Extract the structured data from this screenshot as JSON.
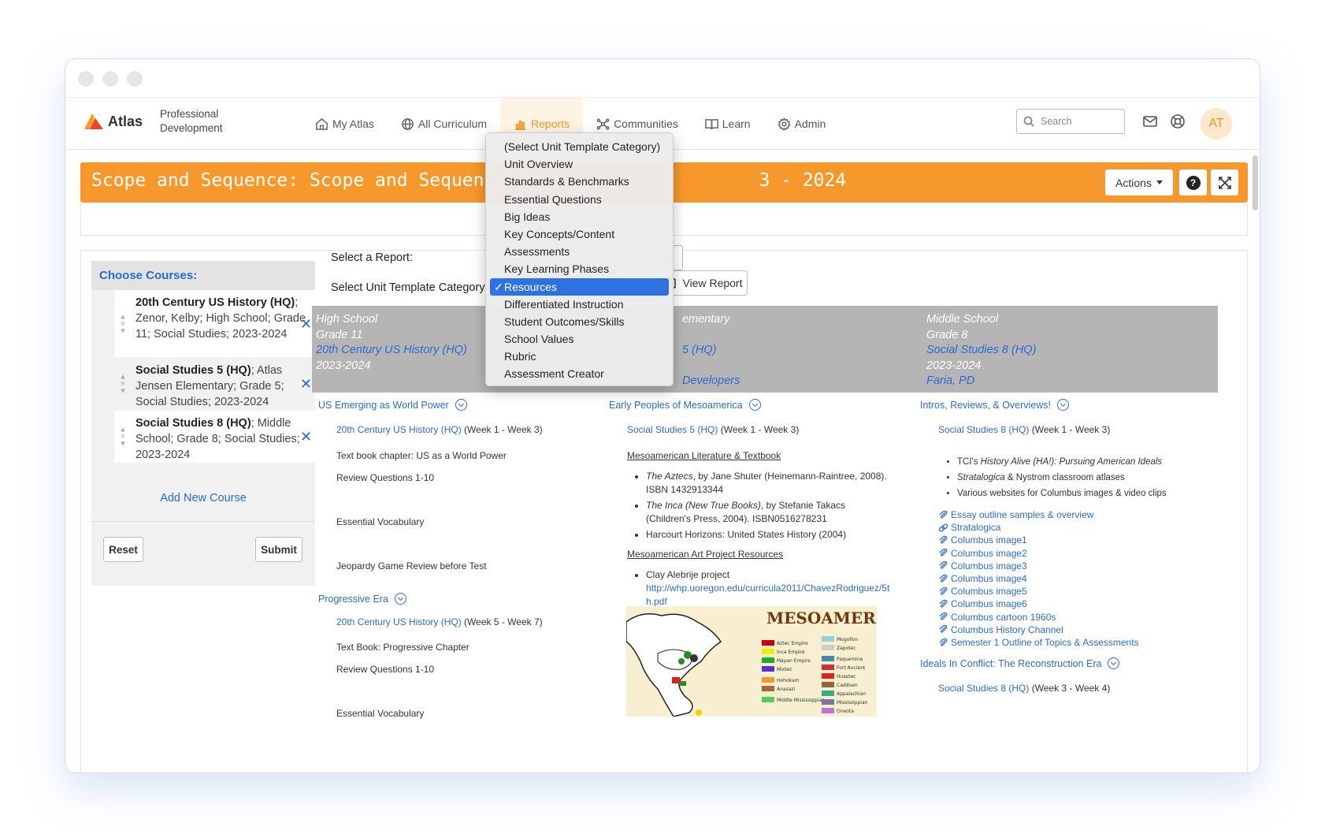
{
  "app": {
    "brand_name": "Atlas",
    "brand_sub": [
      "Professional",
      "Development"
    ],
    "accent_color": "#f7982c",
    "link_color": "#2a6bd1"
  },
  "nav": {
    "items": [
      {
        "label": "My Atlas",
        "icon": "home-icon"
      },
      {
        "label": "All Curriculum",
        "icon": "globe-icon"
      },
      {
        "label": "Reports",
        "icon": "bar-chart-icon",
        "active": true
      },
      {
        "label": "Communities",
        "icon": "network-icon"
      },
      {
        "label": "Learn",
        "icon": "book-icon"
      },
      {
        "label": "Admin",
        "icon": "gear-icon"
      }
    ],
    "search_placeholder": "Search",
    "avatar_initials": "AT"
  },
  "banner": {
    "title_left": "Scope and Sequence: Scope and Sequence Repo",
    "title_right": "3 - 2024",
    "actions_label": "Actions",
    "help_label": "?"
  },
  "left_panel": {
    "header": "Choose Courses:",
    "courses": [
      {
        "name": "20th Century US History (HQ)",
        "detail": "; Zenor, Kelby; High School; Grade 11; Social Studies; 2023-2024"
      },
      {
        "name": "Social Studies 5 (HQ)",
        "detail": "; Atlas Jensen Elementary; Grade 5; Social Studies; 2023-2024"
      },
      {
        "name": "Social Studies 8 (HQ)",
        "detail": "; Middle School; Grade 8; Social Studies; 2023-2024"
      }
    ],
    "add_course": "Add New Course",
    "reset": "Reset",
    "submit": "Submit"
  },
  "form": {
    "select_report_label": "Select a Report:",
    "select_category_label": "Select Unit Template Category:",
    "view_report": "View Report"
  },
  "dropdown": {
    "options": [
      "(Select Unit Template Category)",
      "Unit Overview",
      "Standards & Benchmarks",
      "Essential Questions",
      "Big Ideas",
      "Key Concepts/Content",
      "Assessments",
      "Key Learning Phases",
      "Resources",
      "Differentiated Instruction",
      "Student Outcomes/Skills",
      "School Values",
      "Rubric",
      "Assessment Creator"
    ],
    "selected": "Resources"
  },
  "course_columns": [
    {
      "school": "High School",
      "grade": "Grade 11",
      "course": "20th Century US History (HQ)",
      "year": "2023-2024",
      "teacher": ""
    },
    {
      "school": "ementary",
      "grade": "",
      "course": "5 (HQ)",
      "year": "",
      "teacher": "Developers"
    },
    {
      "school": "Middle School",
      "grade": "Grade 8",
      "course": "Social Studies 8 (HQ)",
      "year": "2023-2024",
      "teacher": "Faria, PD"
    }
  ],
  "col1": {
    "unit1": "US Emerging as World Power",
    "unit1_link": "20th Century US History (HQ)",
    "unit1_weeks": " (Week 1 - Week 3)",
    "unit1_items": [
      "Text book chapter: US as a World Power",
      "Review Questions 1-10",
      "Essential Vocabulary",
      "Jeopardy Game Review before Test"
    ],
    "unit2": "Progressive Era",
    "unit2_link": "20th Century US History (HQ)",
    "unit2_weeks": " (Week 5 - Week 7)",
    "unit2_items": [
      "Text Book: Progressive Chapter",
      "Review Questions 1-10",
      "Essential Vocabulary"
    ]
  },
  "col2": {
    "unit1": "Early Peoples of Mesoamerica",
    "unit1_link": "Social Studies 5 (HQ)",
    "unit1_weeks": " (Week 1 - Week 3)",
    "heading1": "Mesoamerican Literature & Textbook",
    "lit": [
      {
        "title": "The Aztecs",
        "rest": ", by Jane Shuter (Heinemann-Raintree, 2008). ISBN 1432913344"
      },
      {
        "title": "The Inca (New True Books)",
        "rest": ", by Stefanie Takacs (Children's Press, 2004). ISBN0516278231"
      },
      {
        "title": "",
        "rest": "Harcourt Horizons: United States History (2004)"
      }
    ],
    "heading2": "Mesoamerican Art Project Resources",
    "art_item": "Clay Alebrije project",
    "art_url": "http://whp.uoregon.edu/curricula2011/ChavezRodriguez/5th.pdf",
    "map_title": "MESOAMERICA",
    "map_legend_left": [
      "Aztec Empire",
      "Inca Empire",
      "Mayan Empire",
      "Mixtec",
      "Hohokam",
      "Anasazi",
      "Middle Mississippian"
    ],
    "map_legend_right": [
      "Mogollon",
      "Zapotec",
      "Paquemine",
      "Fort Ancient",
      "Huastec",
      "Caddoan",
      "Appalachian",
      "Mississippian",
      "Oneota"
    ]
  },
  "col3": {
    "unit1": "Intros, Reviews, & Overviews!",
    "unit1_link": "Social Studies 8 (HQ)",
    "unit1_weeks": " (Week 1 - Week 3)",
    "bullets": [
      {
        "pre": "TCI's ",
        "it": "History Alive (HA!): Pursuing American Ideals",
        "post": ""
      },
      {
        "pre": "",
        "it": "Stratalogica",
        "post": " & Nystrom classroom atlases"
      },
      {
        "pre": "",
        "it": "",
        "post": "Various websites for Columbus images & video clips"
      }
    ],
    "attachments": [
      "Essay outline samples & overview",
      "Stratalogica",
      "Columbus image1",
      "Columbus image2",
      "Columbus image3",
      "Columbus image4",
      "Columbus image5",
      "Columbus image6",
      "Columbus cartoon 1960s",
      "Columbus History Channel",
      "Semester 1 Outline of Topics & Assessments"
    ],
    "unit2": "Ideals In Conflict: The Reconstruction Era",
    "unit2_link": "Social Studies 8 (HQ)",
    "unit2_weeks": " (Week 3 - Week 4)"
  }
}
